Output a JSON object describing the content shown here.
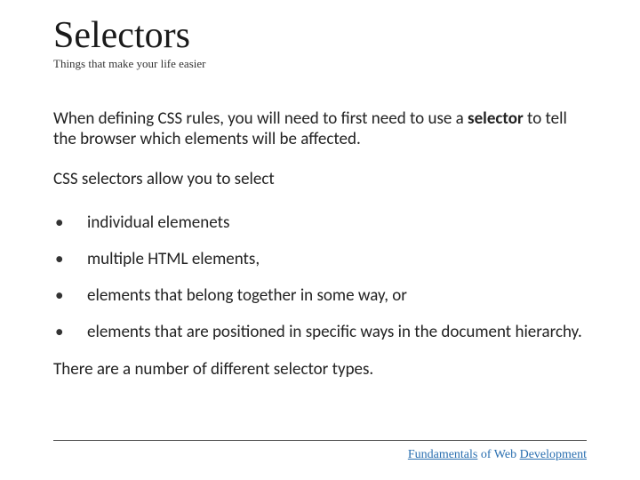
{
  "title": "Selectors",
  "subtitle": "Things that make your life easier",
  "intro_pre": "When defining CSS rules, you will need to first need to use a ",
  "intro_bold": "selector",
  "intro_post": " to tell the browser which elements will be affected.",
  "lead": "CSS selectors allow you to select",
  "bullets": [
    "individual  elemenets",
    "multiple HTML elements,",
    "elements that belong together in some way, or",
    "elements that are positioned in specific ways in the document hierarchy."
  ],
  "closing": "There are a number of different selector types.",
  "footer": {
    "u1": "Fundamentals",
    "mid": " of Web ",
    "u2": "Development"
  }
}
